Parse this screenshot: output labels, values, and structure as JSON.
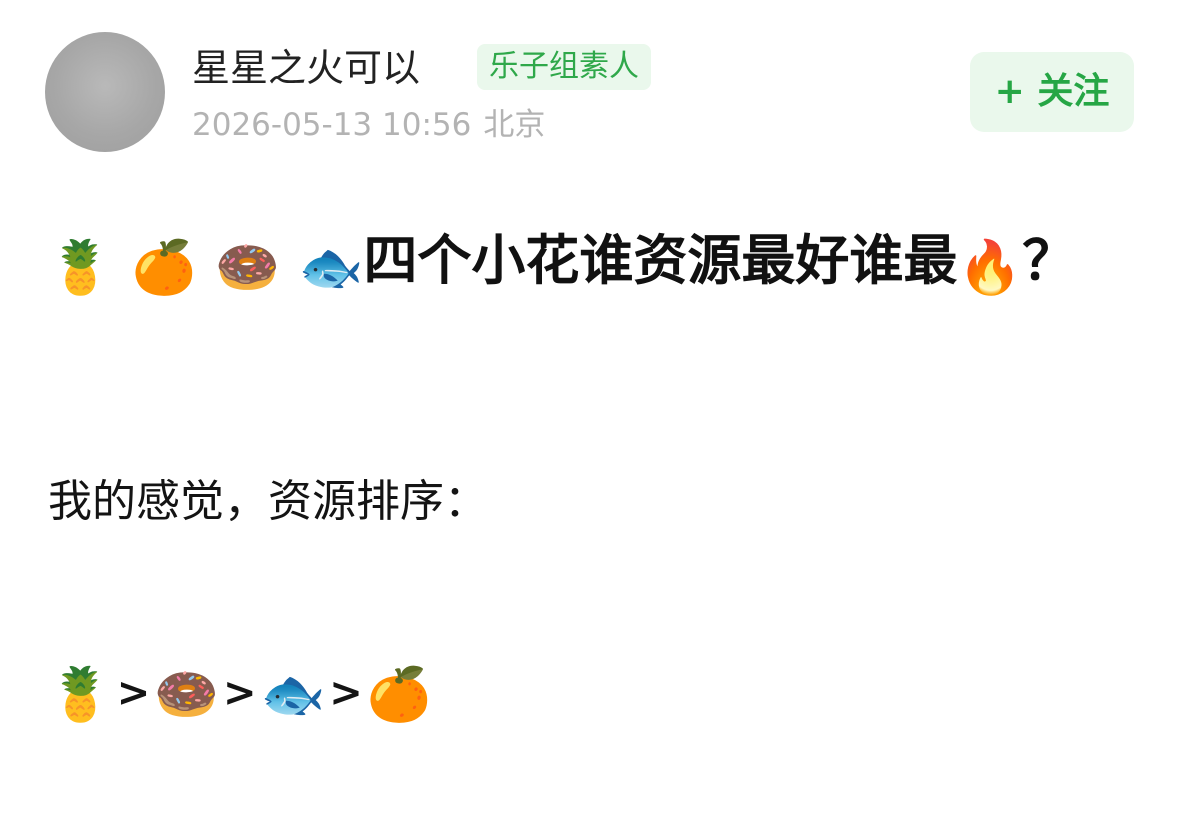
{
  "author": {
    "name": "星星之火可以",
    "badge": "乐子组素人",
    "timestamp": "2026-05-13 10:56",
    "location": "北京"
  },
  "follow_button": {
    "label": "+ 关注"
  },
  "post": {
    "title_emojis": [
      "🍍",
      "🍊",
      "🍩",
      "🐟"
    ],
    "title_text": "四个小花谁资源最好谁最",
    "title_end_emoji": "🔥",
    "title_end_text": "？",
    "paragraph": "我的感觉，资源排序：",
    "ranking": [
      {
        "emoji": "🍍",
        "sep": ">"
      },
      {
        "emoji": "🍩",
        "sep": ">"
      },
      {
        "emoji": "🐟",
        "sep": ">"
      },
      {
        "emoji": "🍊",
        "sep": ""
      }
    ]
  },
  "colors": {
    "accent_green": "#26a645",
    "badge_bg": "#eaf8ec",
    "meta_gray": "#b3b3b3"
  }
}
